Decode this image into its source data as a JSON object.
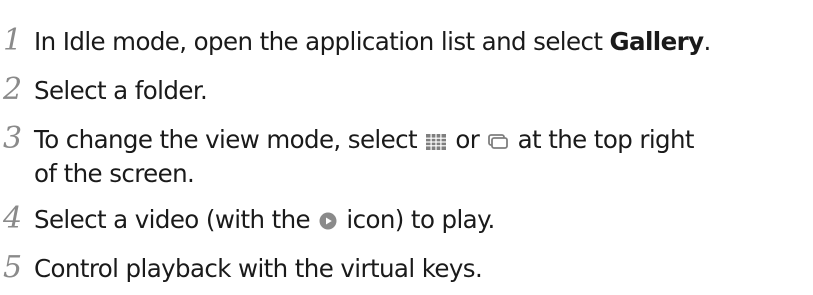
{
  "icons": {
    "grid": "grid-view-icon",
    "folder": "folder-view-icon",
    "play": "play-icon"
  },
  "colors": {
    "step_number": "#8a8a8a",
    "text": "#1a1a1a",
    "icon": "#7f7f7f"
  },
  "steps": [
    {
      "number": "1",
      "text_before": "In Idle mode, open the application list and select ",
      "bold": "Gallery",
      "text_after": "."
    },
    {
      "number": "2",
      "text": "Select a folder."
    },
    {
      "number": "3",
      "text_before": "To change the view mode, select ",
      "text_middle": " or ",
      "text_after": " at the top right",
      "line2": "of the screen."
    },
    {
      "number": "4",
      "text_before": "Select a video (with the ",
      "text_after": " icon) to play."
    },
    {
      "number": "5",
      "text": "Control playback with the virtual keys."
    }
  ]
}
